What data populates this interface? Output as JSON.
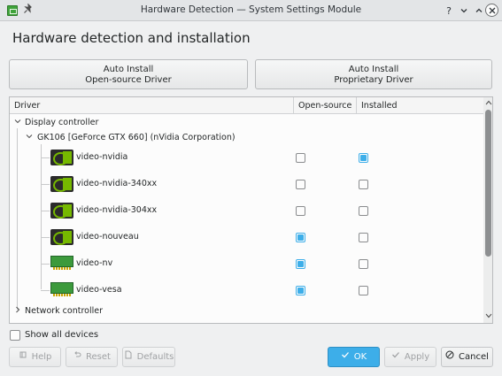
{
  "window": {
    "title": "Hardware Detection — System Settings Module",
    "controls": {
      "help": "?",
      "minimize": "⌄",
      "maximize": "⌃",
      "close": "✕"
    }
  },
  "heading": "Hardware detection and installation",
  "auto_install": {
    "open_source": {
      "line1": "Auto Install",
      "line2": "Open-source Driver"
    },
    "proprietary": {
      "line1": "Auto Install",
      "line2": "Proprietary Driver"
    }
  },
  "tree": {
    "columns": {
      "driver": "Driver",
      "open_source": "Open-source",
      "installed": "Installed"
    },
    "display_controller": "Display controller",
    "device": "GK106 [GeForce GTX 660] (nVidia Corporation)",
    "drivers": [
      {
        "name": "video-nvidia",
        "icon": "nvidia-logo-icon",
        "open_source": false,
        "installed": true
      },
      {
        "name": "video-nvidia-340xx",
        "icon": "nvidia-logo-icon",
        "open_source": false,
        "installed": false
      },
      {
        "name": "video-nvidia-304xx",
        "icon": "nvidia-logo-icon",
        "open_source": false,
        "installed": false
      },
      {
        "name": "video-nouveau",
        "icon": "nvidia-logo-icon",
        "open_source": true,
        "installed": false
      },
      {
        "name": "video-nv",
        "icon": "pci-card-icon",
        "open_source": true,
        "installed": false
      },
      {
        "name": "video-vesa",
        "icon": "pci-card-icon",
        "open_source": true,
        "installed": false
      }
    ],
    "network_controller": "Network controller"
  },
  "show_all_devices": {
    "label": "Show all devices",
    "checked": false
  },
  "buttons": {
    "help": "Help",
    "reset": "Reset",
    "defaults": "Defaults",
    "ok": "OK",
    "apply": "Apply",
    "cancel": "Cancel"
  },
  "colors": {
    "accent": "#3daee9",
    "nvidia_green": "#76b900"
  }
}
